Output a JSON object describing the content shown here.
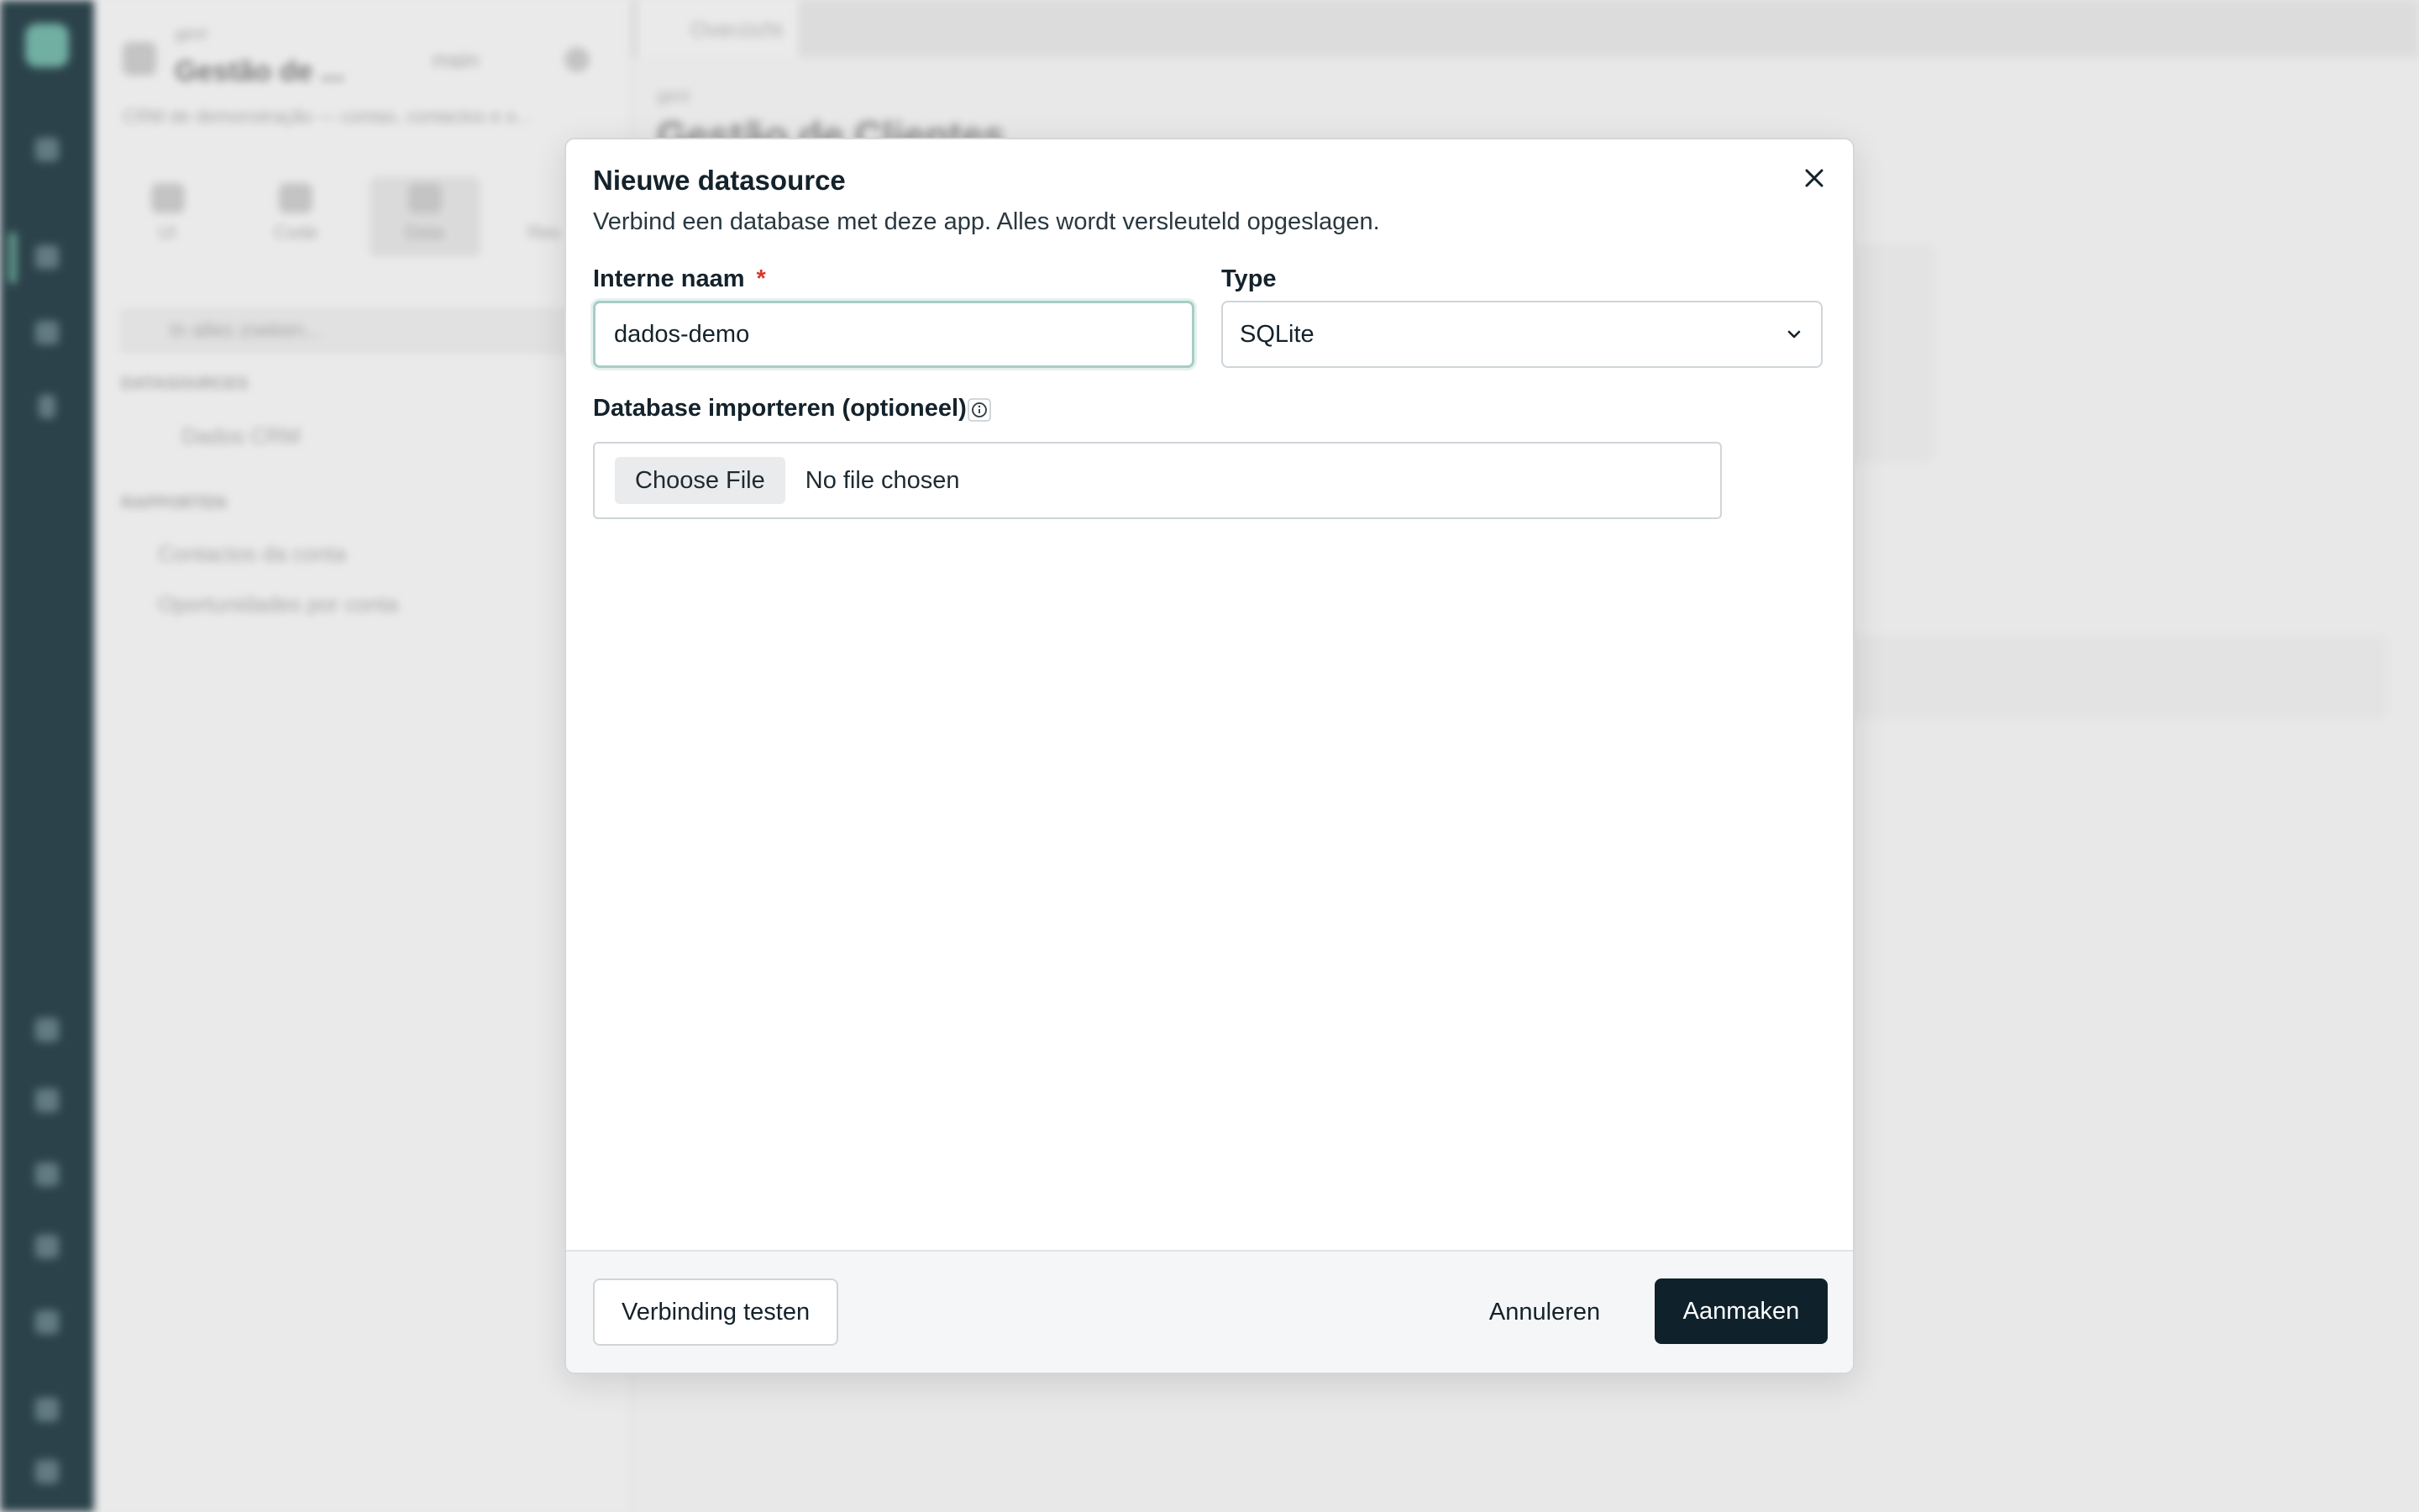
{
  "background": {
    "sidebar": {
      "app_label": "gerir",
      "app_title": "Gestão de ...",
      "branch": "main",
      "description": "CRM de demonstração — contas, contactos e o...",
      "tabs": [
        "UI",
        "Code",
        "Data",
        "Res"
      ],
      "search_placeholder": "In alles zoeken...",
      "datasources_heading": "DATASOURCES",
      "datasource_item": "Dados CRM",
      "queries_heading": "RAPPORTEN",
      "query_items": [
        "Contactos da conta",
        "Oportunidades por conta"
      ]
    },
    "main": {
      "tab_label": "Overzicht",
      "breadcrumb": "gerir",
      "title": "Gestão de Clientes"
    }
  },
  "modal": {
    "title": "Nieuwe datasource",
    "subtitle": "Verbind een database met deze app. Alles wordt versleuteld opgeslagen.",
    "fields": {
      "internal_name_label": "Interne naam",
      "required_mark": "*",
      "internal_name_value": "dados-demo",
      "type_label": "Type",
      "type_value": "SQLite",
      "import_label": "Database importeren (optioneel)",
      "choose_file_label": "Choose File",
      "no_file_text": "No file chosen"
    },
    "footer": {
      "test_button": "Verbinding testen",
      "cancel_button": "Annuleren",
      "create_button": "Aanmaken"
    }
  },
  "colors": {
    "primary_button": "#0f212b",
    "required": "#d33a2c",
    "focus_ring": "#a8ccc6",
    "rail": "#102a33"
  }
}
